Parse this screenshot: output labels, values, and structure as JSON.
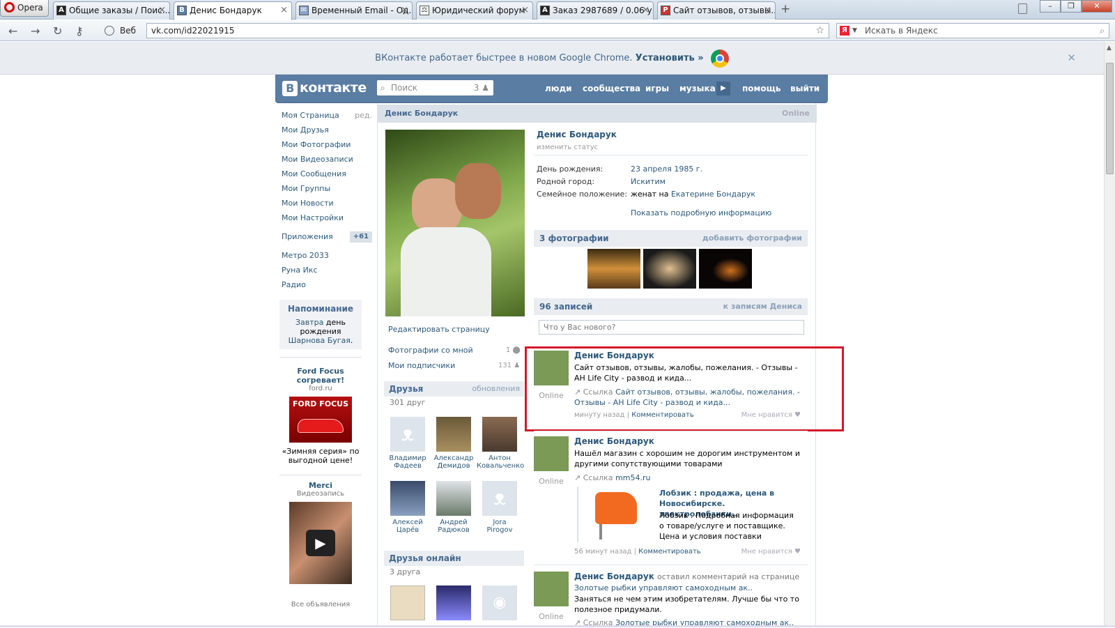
{
  "browser": {
    "menu_label": "Opera",
    "tabs": [
      {
        "icon": "A",
        "title": "Общие заказы / Поис..."
      },
      {
        "icon": "B",
        "title": "Денис Бондарук",
        "active": true
      },
      {
        "icon": "✉",
        "title": "Временный Email - Од..."
      },
      {
        "icon": "⚖",
        "title": "Юридический форум"
      },
      {
        "icon": "A",
        "title": "Заказ 2987689 / 0.06 у..."
      },
      {
        "icon": "P",
        "title": "Сайт отзывов, отзывы..."
      }
    ],
    "web_label": "Веб",
    "url": "vk.com/id22021915",
    "search_placeholder": "Искать в Яндекс"
  },
  "promo": {
    "text": "ВКонтакте работает быстрее в новом Google Chrome.",
    "link": "Установить »"
  },
  "vk": {
    "logo": "контакте",
    "search_placeholder": "Поиск",
    "search_count": "3",
    "nav": [
      "люди",
      "сообщества",
      "игры",
      "музыка",
      "помощь",
      "выйти"
    ]
  },
  "left_menu": {
    "items": [
      "Моя Страница",
      "Мои Друзья",
      "Мои Фотографии",
      "Мои Видеозаписи",
      "Мои Сообщения",
      "Мои Группы",
      "Мои Новости",
      "Мои Настройки"
    ],
    "edit": "ред.",
    "apps": "Приложения",
    "apps_badge": "+61",
    "app_items": [
      "Метро 2033",
      "Руна Икс",
      "Радио"
    ]
  },
  "reminder": {
    "title": "Напоминание",
    "pre": "Завтра",
    "mid": "день рождения",
    "name": "Шарнова Бугая",
    "post": "."
  },
  "ads": [
    {
      "title": "Ford Focus согревает!",
      "domain": "ford.ru",
      "image_text": "FORD FOCUS",
      "desc": "«Зимняя серия» по выгодной цене!"
    },
    {
      "title": "Merci",
      "domain": "Видеозапись"
    }
  ],
  "ads_all": "Все объявления",
  "profile": {
    "header_name": "Денис Бондарук",
    "header_status": "Online",
    "name": "Денис Бондарук",
    "change_status": "изменить статус",
    "info": [
      {
        "label": "День рождения:",
        "value": "23 апреля 1985 г."
      },
      {
        "label": "Родной город:",
        "value": "Искитим"
      },
      {
        "label": "Семейное положение:",
        "value_pre": "женат на",
        "value": "Екатерине Бондарук"
      }
    ],
    "more_info": "Показать подробную информацию",
    "edit_page": "Редактировать страницу",
    "photos_with_me": "Фотографии со мной",
    "photos_with_me_count": "1",
    "subscribers": "Мои подписчики",
    "subscribers_count": "131"
  },
  "friends": {
    "title": "Друзья",
    "updates": "обновления",
    "count": "301 друг",
    "list": [
      {
        "first": "Владимир",
        "last": "Фадеев"
      },
      {
        "first": "Александр",
        "last": "Демидов"
      },
      {
        "first": "Антон",
        "last": "Ковальченко"
      },
      {
        "first": "Алексей",
        "last": "Царёв"
      },
      {
        "first": "Андрей",
        "last": "Радюков"
      },
      {
        "first": "Jora",
        "last": "Pirogov"
      }
    ],
    "online_title": "Друзья онлайн",
    "online_count": "3 друга"
  },
  "photos_block": {
    "title": "3 фотографии",
    "add": "добавить фотографии"
  },
  "wall": {
    "title": "96 записей",
    "link": "к записям Дениса",
    "input_placeholder": "Что у Вас нового?",
    "posts": [
      {
        "author": "Денис Бондарук",
        "online": "Online",
        "text": "Сайт отзывов, отзывы, жалобы, пожелания. - Отзывы - АН Life City - развод и кида...",
        "link_label": "Ссылка",
        "link": "Сайт отзывов, отзывы, жалобы, пожелания. - Отзывы - АН Life City - развод и кида...",
        "time": "минуту назад",
        "comment": "Комментировать",
        "like": "Мне нравится"
      },
      {
        "author": "Денис Бондарук",
        "online": "Online",
        "text": "Нашёл магазин с хорошим не дорогим инструментом и другими сопутствующими товарами",
        "link_label": "Ссылка",
        "link": "mm54.ru",
        "snippet_title": "Лобзик : продажа, цена в Новосибирске. электролобзики..",
        "snippet_text": "Лобзик . Подробная информация о товаре/услуге и поставщике. Цена и условия поставки",
        "time": "56 минут назад",
        "comment": "Комментировать",
        "like": "Мне нравится"
      },
      {
        "author": "Денис Бондарук",
        "action": "оставил комментарий на странице",
        "online": "Online",
        "page": "Золотые рыбки управляют самоходным ак..",
        "text": "Заняться не чем этим изобретателям. Лучше бы что то полезное придумали.",
        "link_label": "Ссылка",
        "link": "Золотые рыбки управляют самоходным ак.."
      }
    ]
  },
  "colors": {
    "vk_blue": "#597da3",
    "link": "#2b587a",
    "highlight": "#d4182a"
  }
}
